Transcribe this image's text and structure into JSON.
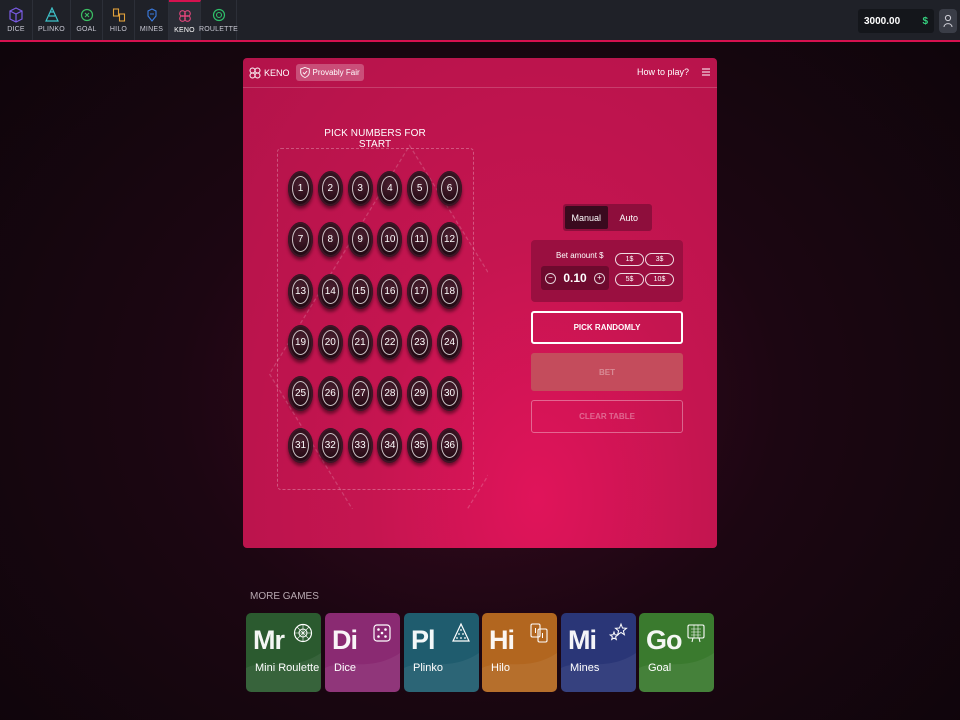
{
  "nav": {
    "items": [
      {
        "label": "DICE",
        "color": "#7b5ce6"
      },
      {
        "label": "PLINKO",
        "color": "#3ec2c9"
      },
      {
        "label": "GOAL",
        "color": "#3bbf63"
      },
      {
        "label": "HILO",
        "color": "#e0a03a"
      },
      {
        "label": "MINES",
        "color": "#3a7be0"
      },
      {
        "label": "KENO",
        "color": "#e0457b"
      },
      {
        "label": "ROULETTE",
        "color": "#2fbf6a"
      }
    ],
    "active": "KENO",
    "balance": "3000.00",
    "currency": "$"
  },
  "panel": {
    "game_label": "KENO",
    "provably_fair": "Provably Fair",
    "how_to_play": "How to play?",
    "pick_title": "PICK NUMBERS FOR START",
    "numbers": [
      "1",
      "2",
      "3",
      "4",
      "5",
      "6",
      "7",
      "8",
      "9",
      "10",
      "11",
      "12",
      "13",
      "14",
      "15",
      "16",
      "17",
      "18",
      "19",
      "20",
      "21",
      "22",
      "23",
      "24",
      "25",
      "26",
      "27",
      "28",
      "29",
      "30",
      "31",
      "32",
      "33",
      "34",
      "35",
      "36"
    ]
  },
  "controls": {
    "mode_manual": "Manual",
    "mode_auto": "Auto",
    "active_mode": "Manual",
    "bet_label": "Bet amount $",
    "bet_value": "0.10",
    "minus": "−",
    "plus": "+",
    "quick": [
      "1$",
      "3$",
      "5$",
      "10$"
    ],
    "pick_randomly": "PICK RANDOMLY",
    "bet": "BET",
    "clear_table": "CLEAR TABLE"
  },
  "more_games": {
    "title": "MORE GAMES",
    "cards": [
      {
        "abbr": "Mr",
        "name": "Mini Roulette",
        "color": "#2b5a2f",
        "icon": "roulette-wheel-icon"
      },
      {
        "abbr": "Di",
        "name": "Dice",
        "color": "#8a2a72",
        "icon": "dice-icon"
      },
      {
        "abbr": "Pl",
        "name": "Plinko",
        "color": "#1f5c6e",
        "icon": "plinko-icon"
      },
      {
        "abbr": "Hi",
        "name": "Hilo",
        "color": "#b2661f",
        "icon": "cards-icon"
      },
      {
        "abbr": "Mi",
        "name": "Mines",
        "color": "#2a3677",
        "icon": "stars-icon"
      },
      {
        "abbr": "Go",
        "name": "Goal",
        "color": "#3a7a2e",
        "icon": "scoreboard-icon"
      }
    ]
  }
}
